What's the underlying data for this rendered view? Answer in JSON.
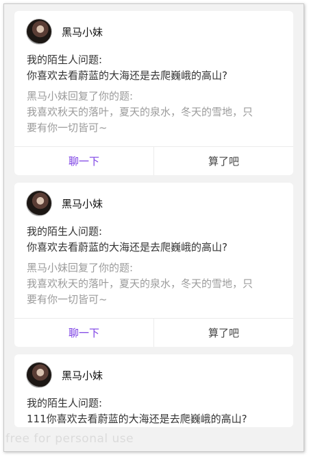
{
  "cards": [
    {
      "name": "黑马小妹",
      "question_label": "我的陌生人问题:",
      "question": "你喜欢去看蔚蓝的大海还是去爬巍峨的高山?",
      "reply_label": "黑马小妹回复了你的题:",
      "reply_line1": "我喜欢秋天的落叶，夏天的泉水，冬天的雪地，只",
      "reply_line2": "要有你一切皆可~",
      "chat_label": "聊一下",
      "skip_label": "算了吧"
    },
    {
      "name": "黑马小妹",
      "question_label": "我的陌生人问题:",
      "question": "你喜欢去看蔚蓝的大海还是去爬巍峨的高山?",
      "reply_label": "黑马小妹回复了你的题:",
      "reply_line1": "我喜欢秋天的落叶，夏天的泉水，冬天的雪地，只",
      "reply_line2": "要有你一切皆可~",
      "chat_label": "聊一下",
      "skip_label": "算了吧"
    },
    {
      "name": "黑马小妹",
      "question_label": "我的陌生人问题:",
      "question": "111你喜欢去看蔚蓝的大海还是去爬巍峨的高山?"
    }
  ],
  "watermark": "free for personal use",
  "colors": {
    "accent": "#7b3fe4",
    "background": "#f2f2f2"
  }
}
